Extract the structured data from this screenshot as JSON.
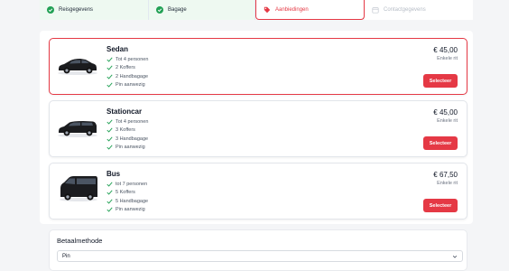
{
  "steps": [
    {
      "label": "Reisgegevens",
      "state": "done"
    },
    {
      "label": "Bagage",
      "state": "done"
    },
    {
      "label": "Aanbiedingen",
      "state": "active"
    },
    {
      "label": "Contactgegevens",
      "state": "upcoming"
    }
  ],
  "vehicles": [
    {
      "name": "Sedan",
      "price": "€ 45,00",
      "ride": "Enkele rit",
      "button": "Selecteer",
      "selected": true,
      "features": [
        "Tot 4 personen",
        "2 Koffers",
        "2 Handbagage",
        "Pin aanwezig"
      ]
    },
    {
      "name": "Stationcar",
      "price": "€ 45,00",
      "ride": "Enkele rit",
      "button": "Selecteer",
      "selected": false,
      "features": [
        "Tot 4 personen",
        "3 Koffers",
        "3 Handbagage",
        "Pin aanwezig"
      ]
    },
    {
      "name": "Bus",
      "price": "€ 67,50",
      "ride": "Enkele rit",
      "button": "Selecteer",
      "selected": false,
      "features": [
        "tot 7 personen",
        "5 Koffers",
        "5 Handbagage",
        "Pin aanwezig"
      ]
    }
  ],
  "payment": {
    "title": "Betaalmethode",
    "selected": "Pin"
  },
  "colors": {
    "accent": "#e53945",
    "success": "#22a155"
  }
}
